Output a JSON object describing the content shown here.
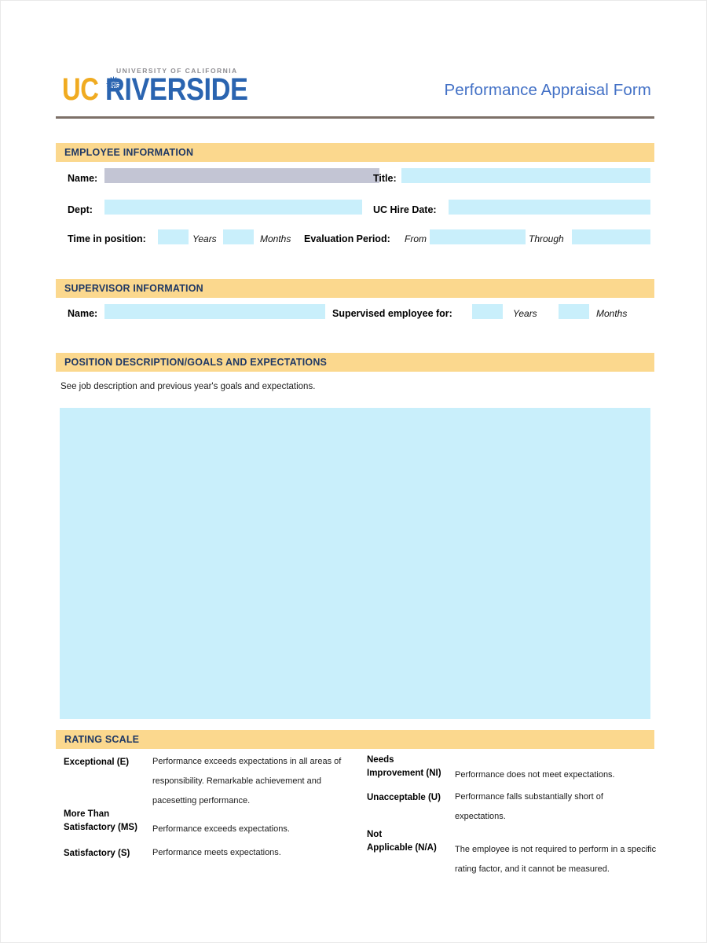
{
  "document": {
    "title": "Performance Appraisal Form",
    "logo": {
      "supertext": "UNIVERSITY OF CALIFORNIA",
      "uc": "UC",
      "riverside": "RIVERSIDE",
      "gold": "#f0ab21",
      "blue": "#2a64b0"
    },
    "colors": {
      "section_bar": "#fbd88e",
      "section_text": "#1f3864",
      "field_fill": "#c9effb",
      "field_fill_focused": "#c3c5d4",
      "title_blue": "#4371c6",
      "rule": "#7d7068"
    }
  },
  "employee_section": {
    "heading": "EMPLOYEE INFORMATION",
    "name_label": "Name:",
    "name_value": "",
    "title_label": "Title:",
    "title_value": "",
    "dept_label": "Dept:",
    "dept_value": "",
    "hire_date_label": "UC Hire Date:",
    "hire_date_value": "",
    "time_in_position_label": "Time in position:",
    "time_years_value": "",
    "years_unit": "Years",
    "time_months_value": "",
    "months_unit": "Months",
    "evaluation_period_label": "Evaluation Period:",
    "from_label": "From",
    "from_value": "",
    "through_label": "Through",
    "through_value": ""
  },
  "supervisor_section": {
    "heading": "SUPERVISOR INFORMATION",
    "name_label": "Name:",
    "name_value": "",
    "supervised_label": "Supervised employee for:",
    "supervised_years_value": "",
    "years_unit": "Years",
    "supervised_months_value": "",
    "months_unit": "Months"
  },
  "position_section": {
    "heading": "POSITION DESCRIPTION/GOALS AND EXPECTATIONS",
    "note": "See job description and previous year's goals and expectations.",
    "textarea_value": ""
  },
  "rating_scale": {
    "heading": "RATING SCALE",
    "left_column": [
      {
        "label": "Exceptional (E)",
        "description": "Performance exceeds expectations in all areas of responsibility. Remarkable achievement and pacesetting performance."
      },
      {
        "label": "More Than\nSatisfactory (MS)",
        "description": "Performance exceeds expectations."
      },
      {
        "label": "Satisfactory (S)",
        "description": "Performance meets expectations."
      }
    ],
    "right_column": [
      {
        "label": "Needs\nImprovement (NI)",
        "description": "Performance does not meet expectations."
      },
      {
        "label": "Unacceptable (U)",
        "description": "Performance falls substantially short of expectations."
      },
      {
        "label": "Not\nApplicable (N/A)",
        "description": "The employee is not required to perform in a specific rating factor, and it cannot be measured."
      }
    ]
  }
}
